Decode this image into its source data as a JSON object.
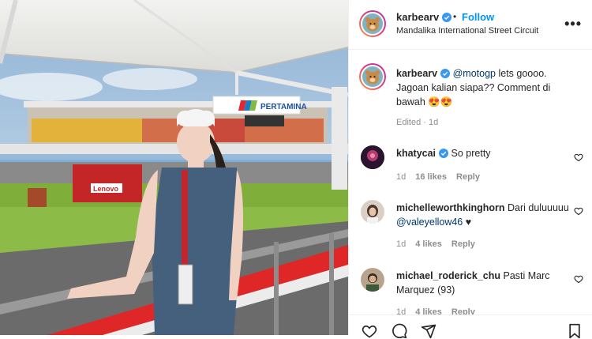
{
  "post": {
    "username": "karbearv",
    "follow_separator": "•",
    "follow_label": "Follow",
    "location": "Mandalika International Street Circuit",
    "more_label": "•••",
    "photo_banner": "PERTAMINA",
    "photo_pit_sign": "Lenovo"
  },
  "caption": {
    "username": "karbearv",
    "mention": "@motogp",
    "text_after_mention": " lets goooo. Jagoan kalian siapa?? Comment di bawah 😍😍",
    "edited": "Edited · 1d"
  },
  "comments": [
    {
      "username": "khatycai",
      "verified": true,
      "text": "So pretty",
      "mention": "",
      "text_after": "",
      "age": "1d",
      "likes": "16 likes",
      "reply": "Reply"
    },
    {
      "username": "michelleworthkinghorn",
      "verified": false,
      "text": "Dari duluuuuu ",
      "mention": "@valeyellow46",
      "text_after": " ♥",
      "age": "1d",
      "likes": "4 likes",
      "reply": "Reply"
    },
    {
      "username": "michael_roderick_chu",
      "verified": false,
      "text": "Pasti Marc Marquez (93)",
      "mention": "",
      "text_after": "",
      "age": "1d",
      "likes": "4 likes",
      "reply": "Reply"
    }
  ],
  "colors": {
    "link_blue": "#0095f6",
    "mention_blue": "#00376b",
    "muted": "#8e8e8e",
    "verified_blue": "#3897f0"
  }
}
